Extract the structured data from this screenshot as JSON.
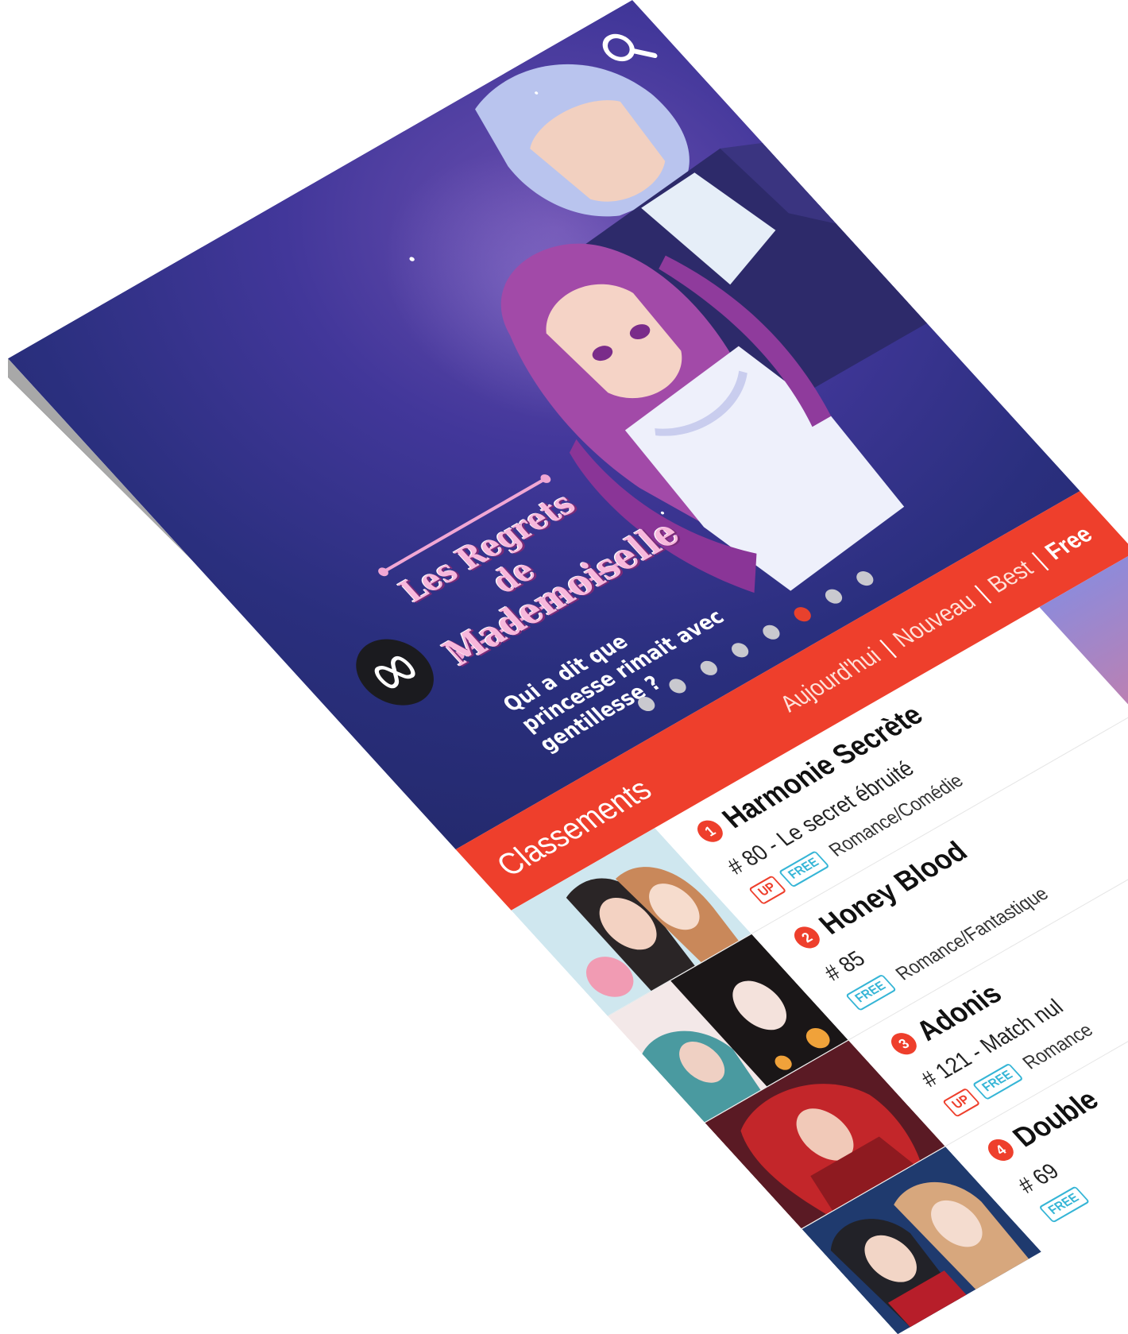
{
  "hero": {
    "title_line1": "Les Regrets de",
    "title_line2": "Mademoiselle",
    "subtitle": "Qui a dit que princesse rimait avec gentillesse ?",
    "dots_total": 8,
    "dot_active": 7
  },
  "rankings": {
    "title": "Classements",
    "filters": [
      {
        "label": "Aujourd'hui",
        "active": false
      },
      {
        "label": "Nouveau",
        "active": false
      },
      {
        "label": "Best",
        "active": false
      },
      {
        "label": "Free",
        "active": true
      }
    ],
    "items": [
      {
        "rank": "1",
        "title": "Harmonie Secrète",
        "meta": "# 80 - Le secret ébruité",
        "up": true,
        "free": true,
        "genre": "Romance/Comédie"
      },
      {
        "rank": "2",
        "title": "Honey Blood",
        "meta": "# 85",
        "up": false,
        "free": true,
        "genre": "Romance/Fantastique"
      },
      {
        "rank": "3",
        "title": "Adonis",
        "meta": "# 121 - Match nul",
        "up": true,
        "free": true,
        "genre": "Romance"
      },
      {
        "rank": "4",
        "title": "Double",
        "meta": "# 69",
        "up": false,
        "free": true,
        "genre": ""
      }
    ],
    "tag_up_label": "UP",
    "tag_free_label": "FREE"
  },
  "colors": {
    "accent": "#ee3f2c",
    "free_tag": "#35b5d6",
    "hero_bg": "#2a2f7e"
  },
  "icons": {
    "search": "search-icon",
    "logo": "brand-logo-icon"
  }
}
